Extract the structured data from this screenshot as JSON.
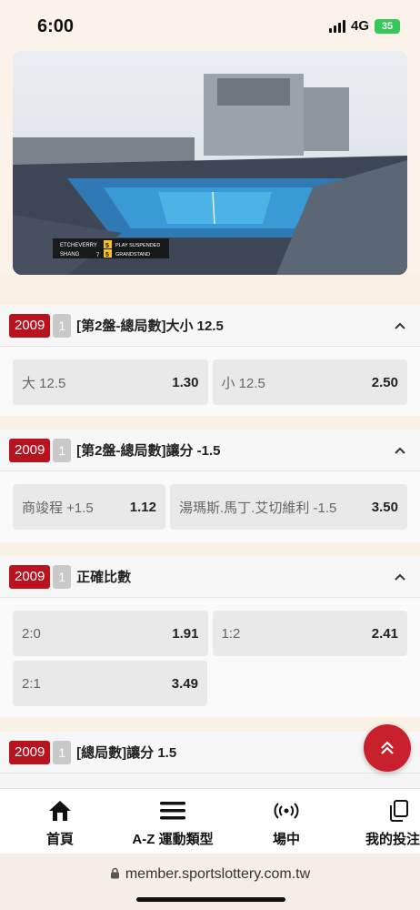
{
  "status": {
    "time": "6:00",
    "network": "4G",
    "battery": "35"
  },
  "video": {
    "player1": "ETCHEVERRY",
    "player2": "SHANG",
    "score_p1": "5",
    "score_p2": "5",
    "games_p2": "7",
    "status_text": "PLAY SUSPENDED",
    "court": "GRANDSTAND"
  },
  "sections": [
    {
      "year": "2009",
      "num": "1",
      "title": "[第2盤-總局數]大小 12.5",
      "rows": [
        [
          {
            "label": "大 12.5",
            "odd": "1.30"
          },
          {
            "label": "小 12.5",
            "odd": "2.50"
          }
        ]
      ]
    },
    {
      "year": "2009",
      "num": "1",
      "title": "[第2盤-總局數]讓分 -1.5",
      "rows": [
        [
          {
            "label": "商竣程 +1.5",
            "odd": "1.12"
          },
          {
            "label": "湯瑪斯.馬丁.艾切維利 -1.5",
            "odd": "3.50"
          }
        ]
      ]
    },
    {
      "year": "2009",
      "num": "1",
      "title": "正確比數",
      "rows": [
        [
          {
            "label": "2:0",
            "odd": "1.91"
          },
          {
            "label": "1:2",
            "odd": "2.41"
          }
        ],
        [
          {
            "label": "2:1",
            "odd": "3.49"
          }
        ]
      ]
    },
    {
      "year": "2009",
      "num": "1",
      "title": "[總局數]讓分 1.5"
    }
  ],
  "nav": {
    "home": "首頁",
    "az": "A-Z 運動類型",
    "live": "場中",
    "mybets": "我的投注"
  },
  "url": "member.sportslottery.com.tw",
  "colors": {
    "accent_red": "#b8141f",
    "fab_red": "#c8202d"
  }
}
